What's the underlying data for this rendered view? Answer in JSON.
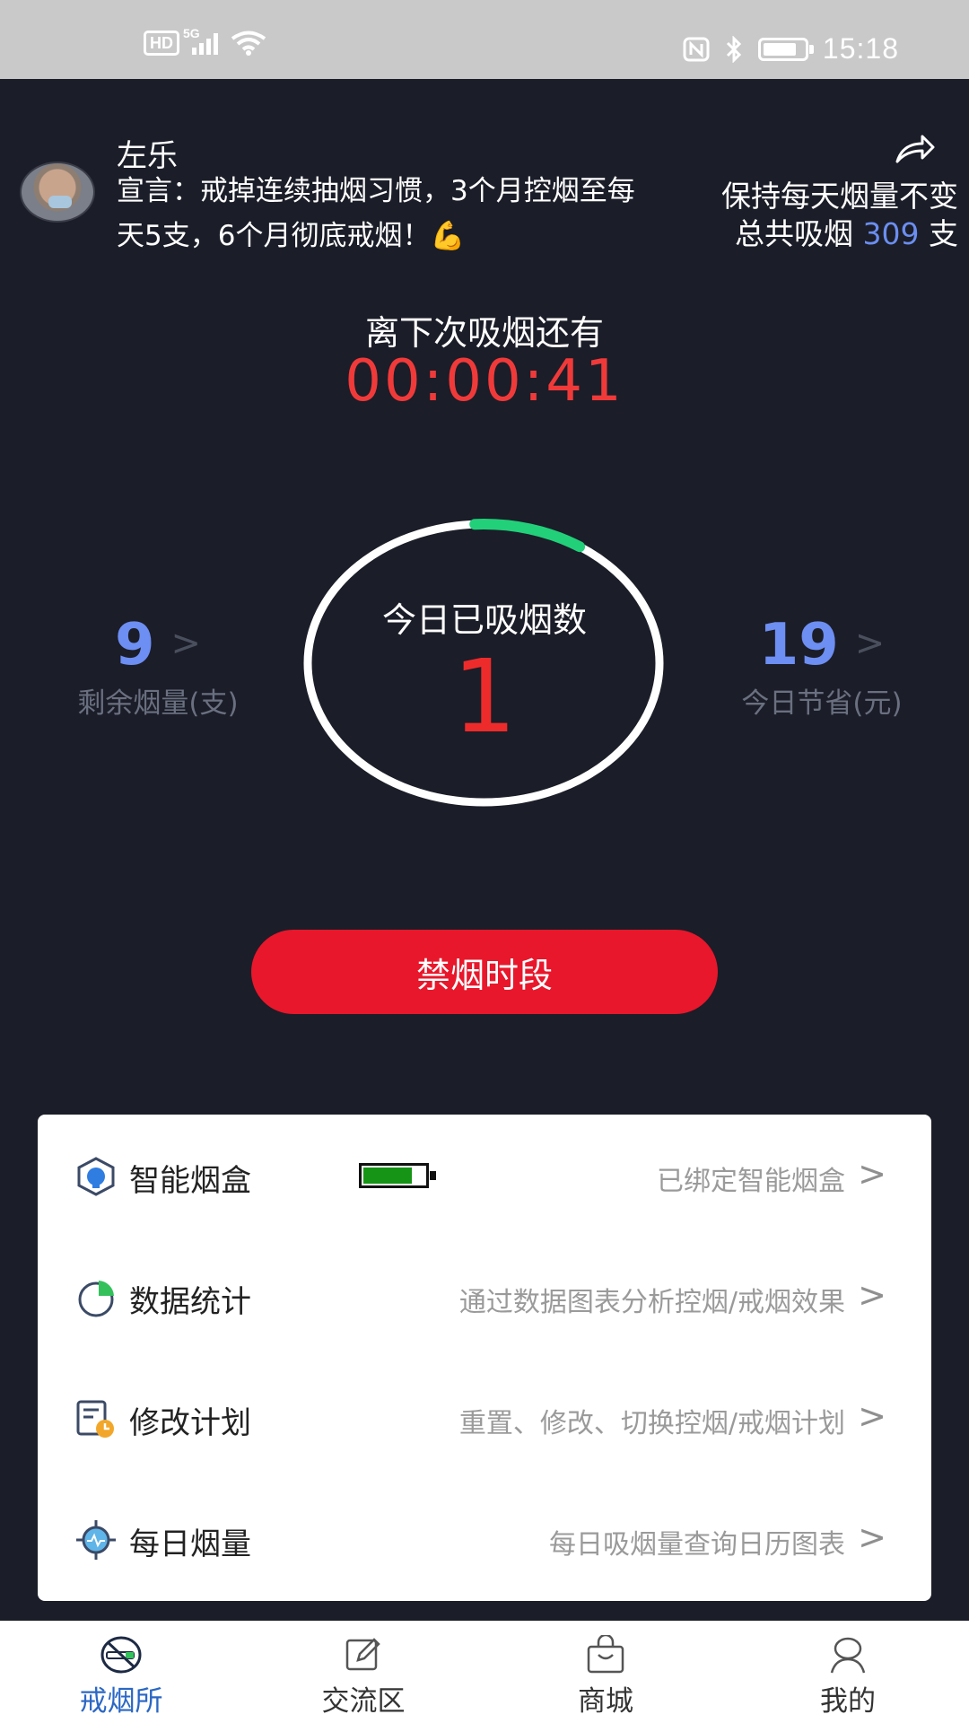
{
  "status_bar": {
    "hd": "HD",
    "network": "5G",
    "time": "15:18"
  },
  "profile": {
    "name": "左乐",
    "declaration": "宣言：戒掉连续抽烟习惯，3个月控烟至每天5支，6个月彻底戒烟！💪",
    "plan_line1": "保持每天烟量不变",
    "plan_prefix": "总共吸烟",
    "plan_total": "309",
    "plan_unit": "支"
  },
  "countdown": {
    "label": "离下次吸烟还有",
    "time": "00:00:41"
  },
  "today": {
    "label": "今日已吸烟数",
    "count": "1",
    "progress_fraction": 0.1
  },
  "stats": {
    "remaining": {
      "value": "9",
      "label": "剩余烟量(支)"
    },
    "saved": {
      "value": "19",
      "label": "今日节省(元)"
    }
  },
  "ban_button": "禁烟时段",
  "menu": [
    {
      "title": "智能烟盒",
      "desc": "已绑定智能烟盒",
      "icon": "smart-box-icon",
      "battery_level": 0.8
    },
    {
      "title": "数据统计",
      "desc": "通过数据图表分析控烟/戒烟效果",
      "icon": "pie-chart-icon"
    },
    {
      "title": "修改计划",
      "desc": "重置、修改、切换控烟/戒烟计划",
      "icon": "plan-edit-icon"
    },
    {
      "title": "每日烟量",
      "desc": "每日吸烟量查询日历图表",
      "icon": "daily-target-icon"
    }
  ],
  "nav": [
    {
      "label": "戒烟所",
      "icon": "no-smoking-icon",
      "active": true
    },
    {
      "label": "交流区",
      "icon": "edit-note-icon",
      "active": false
    },
    {
      "label": "商城",
      "icon": "shop-bag-icon",
      "active": false
    },
    {
      "label": "我的",
      "icon": "profile-icon",
      "active": false
    }
  ],
  "colors": {
    "background": "#1b1d28",
    "accent_red": "#e8172b",
    "stat_blue": "#6d8ef2",
    "progress_green": "#22d07a",
    "nav_active": "#2b67c4"
  }
}
